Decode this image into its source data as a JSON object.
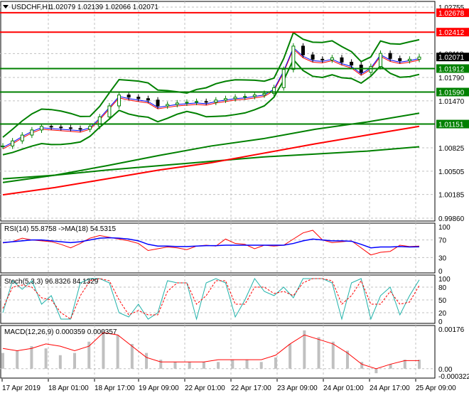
{
  "header": {
    "symbol": "USDCHF,H1",
    "ohlc": "1.02079 1.02139 1.02066 1.02071"
  },
  "colors": {
    "bull": "#008000",
    "bear": "#000000",
    "resistance": "#ff0000",
    "support": "#008000",
    "rsi": "#ff0000",
    "rsi_ma": "#0000ff",
    "stoch_main": "#20b2aa",
    "stoch_signal": "#ff0000",
    "macd_hist": "#c0c0c0",
    "macd_signal": "#ff0000"
  },
  "chart_data": [
    {
      "type": "line",
      "title": "USDCHF,H1",
      "ylim": [
        0.9986,
        1.02755
      ],
      "yticks": [
        "1.02755",
        "1.02118",
        "1.01790",
        "1.01470",
        "1.00825",
        "1.00505",
        "1.00185",
        "0.99860"
      ],
      "levels": [
        {
          "value": "1.02678",
          "kind": "resistance"
        },
        {
          "value": "1.02412",
          "kind": "resistance"
        },
        {
          "value": "1.01912",
          "kind": "support"
        },
        {
          "value": "1.01590",
          "kind": "support"
        },
        {
          "value": "1.01151",
          "kind": "support"
        }
      ],
      "current_price": "1.02071",
      "close": [
        1.0085,
        1.0092,
        1.01,
        1.0107,
        1.0112,
        1.0111,
        1.011,
        1.0109,
        1.0108,
        1.0112,
        1.0125,
        1.014,
        1.0155,
        1.0152,
        1.015,
        1.0148,
        1.014,
        1.0142,
        1.0144,
        1.0145,
        1.0146,
        1.0145,
        1.0148,
        1.015,
        1.0152,
        1.0153,
        1.0155,
        1.0157,
        1.0165,
        1.019,
        1.0222,
        1.021,
        1.0204,
        1.0203,
        1.0206,
        1.02,
        1.0196,
        1.0186,
        1.0194,
        1.0212,
        1.0205,
        1.0202,
        1.0204,
        1.0207
      ],
      "ma_slow": [
        1.0035,
        1.0045,
        1.0058,
        1.0072,
        1.0085,
        1.0095,
        1.0108,
        1.0118,
        1.013
      ],
      "ma_200": [
        1.0018,
        1.0028,
        1.004,
        1.0052,
        1.0062,
        1.0075,
        1.0088,
        1.01,
        1.0112
      ],
      "ma_long": [
        1.004,
        1.0045,
        1.0052,
        1.0058,
        1.0064,
        1.007,
        1.0074,
        1.0078,
        1.0084
      ]
    },
    {
      "type": "line",
      "title": "RSI(14) 55.8758 ->MA(18) 54.5315",
      "yticks": [
        "100",
        "70",
        "30",
        "0"
      ],
      "ylim": [
        0,
        100
      ],
      "rsi": [
        63,
        66,
        74,
        70,
        68,
        66,
        60,
        52,
        62,
        74,
        80,
        76,
        72,
        68,
        62,
        46,
        50,
        54,
        52,
        48,
        56,
        58,
        56,
        72,
        62,
        60,
        50,
        58,
        56,
        58,
        72,
        86,
        92,
        70,
        64,
        66,
        68,
        52,
        36,
        42,
        44,
        58,
        55,
        56
      ],
      "ma": [
        64,
        66,
        68,
        70,
        70,
        68,
        66,
        64,
        66,
        70,
        74,
        75,
        74,
        72,
        68,
        60,
        56,
        56,
        55,
        55,
        56,
        57,
        57,
        58,
        58,
        58,
        58,
        58,
        58,
        58,
        62,
        68,
        72,
        70,
        68,
        68,
        67,
        60,
        52,
        54,
        54,
        55,
        54,
        54.5
      ]
    },
    {
      "type": "line",
      "title": "Stoch(5,3,3) 96.8326 84.1329",
      "yticks": [
        "100",
        "80",
        "50",
        "20",
        "0"
      ],
      "ylim": [
        0,
        100
      ],
      "main": [
        20,
        95,
        75,
        95,
        40,
        60,
        5,
        5,
        90,
        100,
        100,
        90,
        20,
        10,
        40,
        5,
        20,
        95,
        90,
        90,
        5,
        90,
        100,
        90,
        10,
        50,
        100,
        70,
        60,
        80,
        55,
        100,
        100,
        100,
        90,
        5,
        90,
        100,
        5,
        60,
        80,
        15,
        60,
        97
      ],
      "signal": [
        30,
        80,
        85,
        80,
        55,
        50,
        20,
        5,
        60,
        95,
        100,
        95,
        50,
        15,
        25,
        15,
        15,
        70,
        90,
        90,
        40,
        60,
        95,
        95,
        40,
        40,
        80,
        80,
        65,
        70,
        60,
        90,
        100,
        100,
        95,
        40,
        60,
        95,
        40,
        40,
        70,
        40,
        45,
        84
      ]
    },
    {
      "type": "bar",
      "title": "MACD(12,26,9) 0.000359 0.000357",
      "yticks": [
        "0.00176",
        "0.00",
        "-0.000322"
      ],
      "ylim": [
        -0.000322,
        0.00176
      ],
      "hist": [
        0.0007,
        0.0008,
        0.001,
        0.0009,
        0.0006,
        0.0007,
        0.0012,
        0.0017,
        0.0015,
        0.0011,
        0.0007,
        0.0004,
        0.0003,
        0.0003,
        0.0003,
        0.0003,
        0.0004,
        0.0004,
        0.0003,
        0.0005,
        0.0011,
        0.0017,
        0.0014,
        0.0012,
        0.0008,
        0.0003,
        -0.0002,
        0.0002,
        0.0004,
        0.0004
      ],
      "signal": [
        0.0009,
        0.0008,
        0.0009,
        0.0011,
        0.001,
        0.0008,
        0.001,
        0.0016,
        0.0015,
        0.001,
        0.0005,
        0.0003,
        0.0003,
        0.0003,
        0.0003,
        0.0004,
        0.0004,
        0.0004,
        0.0004,
        0.0006,
        0.0011,
        0.0015,
        0.0013,
        0.0011,
        0.0007,
        0.0002,
        0.0,
        0.0002,
        0.00036,
        0.00036
      ]
    }
  ],
  "time_axis": [
    "17 Apr 2019",
    "18 Apr 01:00",
    "18 Apr 17:00",
    "19 Apr 09:00",
    "22 Apr 01:00",
    "22 Apr 17:00",
    "23 Apr 09:00",
    "24 Apr 01:00",
    "24 Apr 17:00",
    "25 Apr 09:00"
  ]
}
